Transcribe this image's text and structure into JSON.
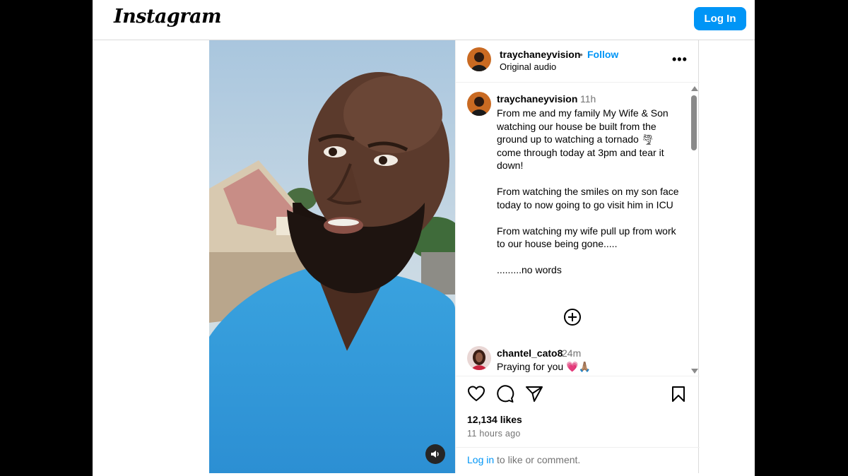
{
  "header": {
    "logo_text": "Instagram",
    "login_label": "Log In"
  },
  "post": {
    "username": "traychaneyvision",
    "follow_label": "Follow",
    "separator": "•",
    "audio_label": "Original audio",
    "more_label": "•••",
    "caption_time": "11h",
    "caption_paragraphs": [
      "From me and my family My Wife & Son watching our house be built from the ground up to watching a tornado 🌪 come through today at 3pm and tear it down!",
      "From watching the smiles on my son face today to now going to go visit him in ICU",
      "From watching my wife pull up from work to our house being gone.....",
      ".........no words"
    ],
    "comment": {
      "username": "chantel_cato8",
      "time": "24m",
      "text": "Praying for you 💗🙏🏽"
    },
    "likes": "12,134 likes",
    "posted_ago": "11 hours ago",
    "login_link": "Log in",
    "login_suffix": " to like or comment."
  },
  "icons": {
    "like": "heart-icon",
    "comment": "comment-icon",
    "share": "send-icon",
    "save": "bookmark-icon",
    "sound": "speaker-icon",
    "expand": "plus-circle-icon",
    "more": "more-dots-icon"
  },
  "colors": {
    "accent": "#0095f6",
    "text": "#000000",
    "muted": "#737373",
    "border": "#dbdbdb"
  }
}
